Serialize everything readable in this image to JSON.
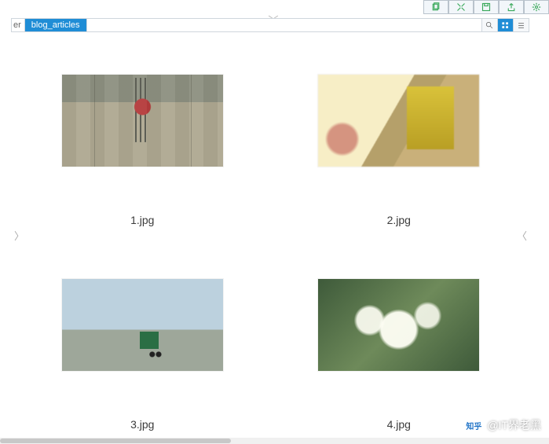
{
  "toolbar": {
    "buttons": [
      {
        "name": "copy-icon"
      },
      {
        "name": "expand-icon"
      },
      {
        "name": "save-icon"
      },
      {
        "name": "share-icon"
      },
      {
        "name": "settings-icon"
      }
    ]
  },
  "path": {
    "prefix": "er",
    "segment": "blog_articles"
  },
  "pathIcons": {
    "search": "search-icon",
    "grid": "grid-view-icon",
    "list": "list-view-icon"
  },
  "files": [
    {
      "name": "1.jpg"
    },
    {
      "name": "2.jpg"
    },
    {
      "name": "3.jpg"
    },
    {
      "name": "4.jpg"
    }
  ],
  "nav": {
    "prev": "〉",
    "next": "〈",
    "collapse": "〉"
  },
  "watermark": {
    "logo": "知乎",
    "text": "@IT界老黑"
  }
}
